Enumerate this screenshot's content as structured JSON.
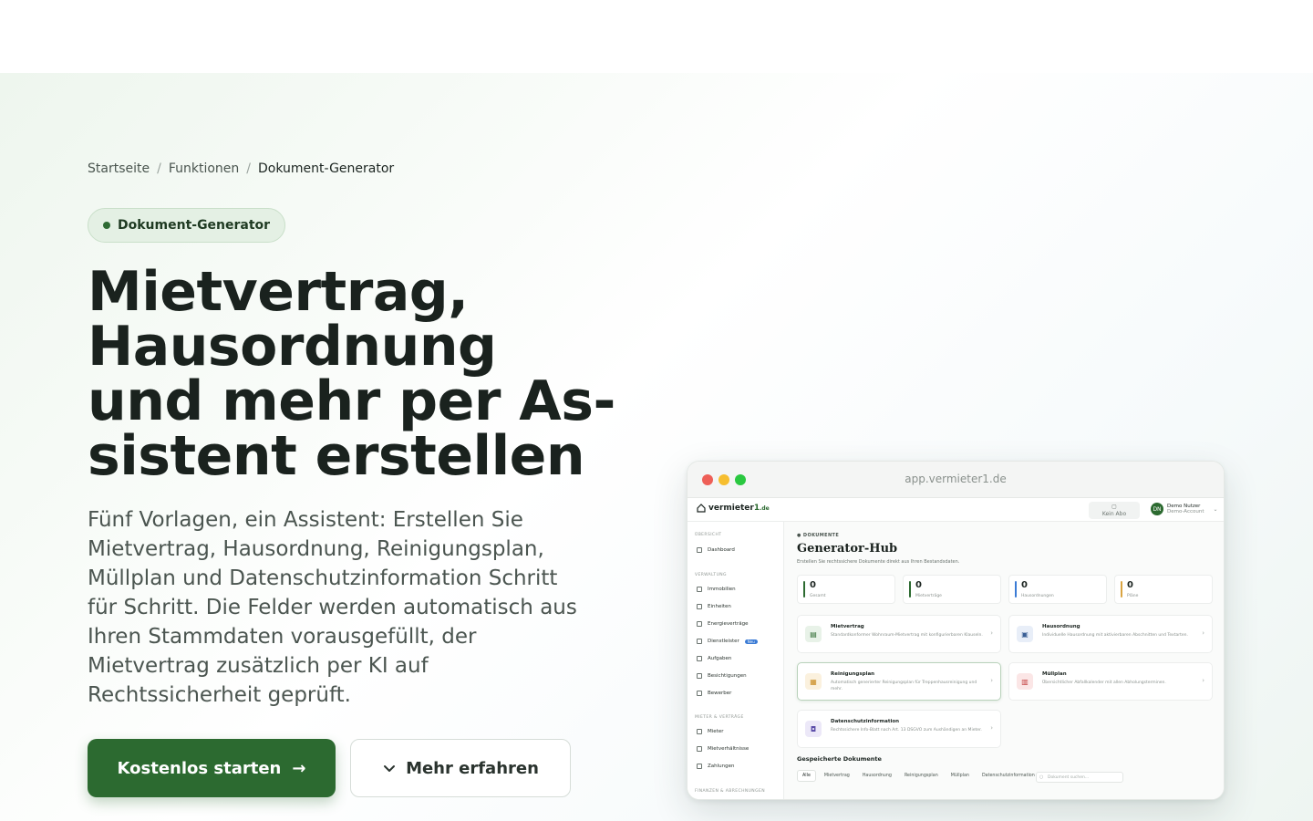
{
  "breadcrumb": {
    "items": [
      "Startseite",
      "Funktionen",
      "Dokument-Generator"
    ],
    "separator": "/"
  },
  "badge": {
    "label": "Dokument-Generator"
  },
  "hero": {
    "headline_lines": [
      "Mietvertrag,",
      "Hausordnung",
      "und mehr per As-",
      "sistent erstellen"
    ],
    "lead_lines": [
      "Fünf Vorlagen, ein Assistent: Erstellen Sie",
      "Mietvertrag, Hausordnung, Reinigungsplan,",
      "Müllplan und Datenschutzinformation Schritt",
      "für Schritt. Die Felder werden automatisch aus",
      "Ihren Stammdaten vorausgefüllt, der",
      "Mietvertrag zusätzlich per KI auf",
      "Rechtssicherheit geprüft."
    ],
    "primary_button": "Kostenlos starten",
    "primary_arrow": "→",
    "secondary_button": "Mehr erfahren",
    "secondary_chevron": "⌄"
  },
  "colors": {
    "brand": "#2c6a30",
    "dot_red": "#ee5f57",
    "dot_yellow": "#f6be2f",
    "dot_green": "#2ac840"
  },
  "mockup": {
    "url": "app.vermieter1.de",
    "logo": {
      "text": "vermieter",
      "one": "1",
      "tld": ".de"
    },
    "abo": "Kein Abo",
    "user": {
      "initials": "DN",
      "name": "Demo Nutzer",
      "role": "Demo-Account"
    },
    "sidebar": {
      "sections": [
        {
          "title": "ÜBERSICHT",
          "items": [
            {
              "label": "Dashboard"
            }
          ]
        },
        {
          "title": "VERWALTUNG",
          "items": [
            {
              "label": "Immobilien"
            },
            {
              "label": "Einheiten"
            },
            {
              "label": "Energieverträge"
            },
            {
              "label": "Dienstleister",
              "tag": "Neu"
            },
            {
              "label": "Aufgaben"
            },
            {
              "label": "Besichtigungen"
            },
            {
              "label": "Bewerber"
            }
          ]
        },
        {
          "title": "MIETER & VERTRÄGE",
          "items": [
            {
              "label": "Mieter"
            },
            {
              "label": "Mietverhältnisse"
            },
            {
              "label": "Zahlungen"
            }
          ]
        },
        {
          "title": "FINANZEN & ABRECHNUNGEN",
          "items": []
        }
      ]
    },
    "main": {
      "kicker": "DOKUMENTE",
      "title": "Generator-Hub",
      "subtitle": "Erstellen Sie rechtssichere Dokumente direkt aus Ihren Bestandsdaten.",
      "stats": [
        {
          "value": "0",
          "label": "Gesamt",
          "color": "#2c6a30"
        },
        {
          "value": "0",
          "label": "Mietverträge",
          "color": "#2c6a30"
        },
        {
          "value": "0",
          "label": "Hausordnungen",
          "color": "#3a7bd5"
        },
        {
          "value": "0",
          "label": "Pläne",
          "color": "#d9a441"
        }
      ],
      "cards": [
        {
          "title": "Mietvertrag",
          "desc": "Standardkonformer Wohnraum-Mietvertrag mit konfigurierbaren Klauseln.",
          "icon": "document-icon",
          "glyph": "▤",
          "bg": "#e8f2e8",
          "fg": "#2c6a30"
        },
        {
          "title": "Hausordnung",
          "desc": "Individuelle Hausordnung mit aktivierbaren Abschnitten und Textarten.",
          "icon": "clipboard-icon",
          "glyph": "▣",
          "bg": "#e8eef8",
          "fg": "#3a5f95"
        },
        {
          "title": "Reinigungsplan",
          "desc": "Automatisch generierter Reinigungsplan für Treppenhausreinigung und mehr.",
          "icon": "calendar-icon",
          "glyph": "▦",
          "bg": "#fbf1de",
          "fg": "#c98a1e"
        },
        {
          "title": "Müllplan",
          "desc": "Übersichtlicher Abfallkalender mit allen Abholungsterminen.",
          "icon": "trash-icon",
          "glyph": "🗑",
          "bg": "#fbe6e6",
          "fg": "#c23b3b"
        },
        {
          "title": "Datenschutzinformation",
          "desc": "Rechtssichere Info-Blatt nach Art. 13 DSGVO zum Aushändigen an Mieter.",
          "icon": "lock-icon",
          "glyph": "🔒",
          "bg": "#ece8f8",
          "fg": "#5a4ba8"
        }
      ],
      "saved_title": "Gespeicherte Dokumente",
      "filters": [
        "Alle",
        "Mietvertrag",
        "Hausordnung",
        "Reinigungsplan",
        "Müllplan",
        "Datenschutzinformation"
      ],
      "search_placeholder": "Dokument suchen..."
    }
  }
}
